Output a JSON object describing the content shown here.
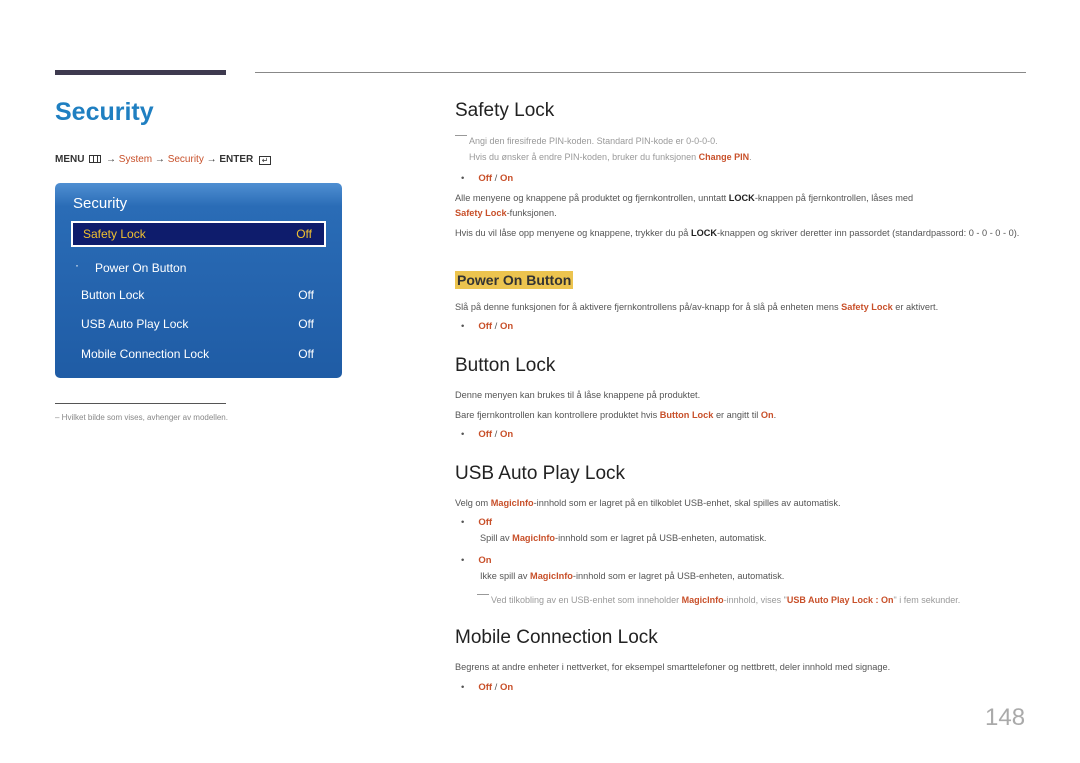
{
  "header": {
    "title": "Security"
  },
  "breadcrumb": {
    "menu": "MENU",
    "arrow": "→",
    "system": "System",
    "security": "Security",
    "enter": "ENTER",
    "enter_icon": "↵"
  },
  "osd": {
    "title": "Security",
    "items": [
      {
        "label": "Safety Lock",
        "value": "Off",
        "selected": true
      },
      {
        "label": "Power On Button",
        "value": "",
        "sub": true,
        "bullet": "·"
      },
      {
        "label": "Button Lock",
        "value": "Off"
      },
      {
        "label": "USB Auto Play Lock",
        "value": "Off"
      },
      {
        "label": "Mobile Connection Lock",
        "value": "Off"
      }
    ]
  },
  "footnote": "–  Hvilket bilde som vises, avhenger av modellen.",
  "sections": {
    "safety_lock": {
      "title": "Safety Lock",
      "note1": "Angi den firesifrede PIN-koden. Standard PIN-kode er 0-0-0-0.",
      "note2_pre": "Hvis du ønsker å endre PIN-koden, bruker du funksjonen ",
      "note2_link": "Change PIN",
      "note2_post": ".",
      "opt_off": "Off",
      "opt_sep": " / ",
      "opt_on": "On",
      "p1_pre": "Alle menyene og knappene på produktet og fjernkontrollen, unntatt ",
      "p1_bold": "LOCK",
      "p1_mid": "-knappen på fjernkontrollen, låses med",
      "p1_link": "Safety Lock",
      "p1_post": "-funksjonen.",
      "p2_pre": "Hvis du vil låse opp menyene og knappene, trykker du på ",
      "p2_bold": "LOCK",
      "p2_post": "-knappen og skriver deretter inn passordet (standardpassord: 0 - 0 - 0 - 0)."
    },
    "power_on_button": {
      "title": "Power On Button",
      "p_pre": "Slå på denne funksjonen for å aktivere fjernkontrollens på/av-knapp for å slå på enheten mens ",
      "p_link": "Safety Lock",
      "p_post": " er aktivert.",
      "opt_off": "Off",
      "opt_sep": " / ",
      "opt_on": "On"
    },
    "button_lock": {
      "title": "Button Lock",
      "p1": "Denne menyen kan brukes til å låse knappene på produktet.",
      "p2_pre": "Bare fjernkontrollen kan kontrollere produktet hvis ",
      "p2_link": "Button Lock",
      "p2_mid": " er angitt til ",
      "p2_on": "On",
      "p2_post": ".",
      "opt_off": "Off",
      "opt_sep": " / ",
      "opt_on": "On"
    },
    "usb_auto_play_lock": {
      "title": "USB Auto Play Lock",
      "p_pre": "Velg om ",
      "p_link": "MagicInfo",
      "p_post": "-innhold som er lagret på en tilkoblet USB-enhet, skal spilles av automatisk.",
      "off_label": "Off",
      "off_desc_pre": "Spill av ",
      "off_desc_link": "MagicInfo",
      "off_desc_post": "-innhold som er lagret på USB-enheten, automatisk.",
      "on_label": "On",
      "on_desc_pre": "Ikke spill av ",
      "on_desc_link": "MagicInfo",
      "on_desc_post": "-innhold som er lagret på USB-enheten, automatisk.",
      "note_pre": "Ved tilkobling av en USB-enhet som inneholder ",
      "note_link": "MagicInfo",
      "note_mid": "-innhold, vises \"",
      "note_msg": "USB Auto Play Lock : On",
      "note_post": "\" i fem sekunder."
    },
    "mobile_connection_lock": {
      "title": "Mobile Connection Lock",
      "p": "Begrens at andre enheter i nettverket, for eksempel smarttelefoner og nettbrett, deler innhold med signage.",
      "opt_off": "Off",
      "opt_sep": " / ",
      "opt_on": "On"
    }
  },
  "page_number": "148"
}
